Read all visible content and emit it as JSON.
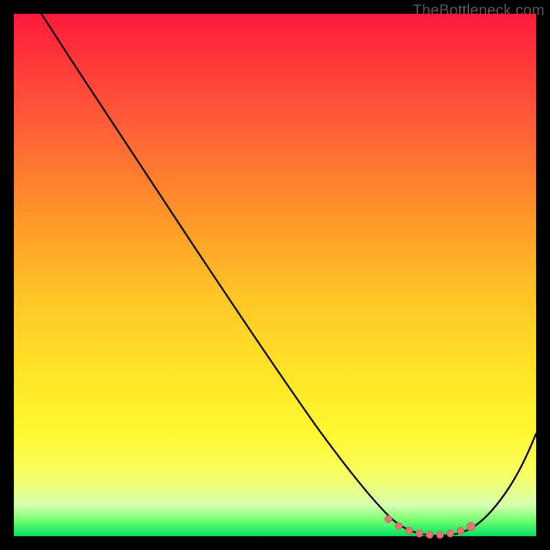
{
  "watermark": "TheBottleneck.com",
  "chart_data": {
    "type": "line",
    "title": "",
    "xlabel": "",
    "ylabel": "",
    "xlim": [
      0,
      100
    ],
    "ylim": [
      0,
      100
    ],
    "grid": false,
    "legend": false,
    "series": [
      {
        "name": "bottleneck-curve",
        "x": [
          0,
          5,
          10,
          15,
          20,
          25,
          30,
          35,
          40,
          45,
          50,
          55,
          60,
          65,
          70,
          73,
          76,
          79,
          82,
          85,
          88,
          91,
          94,
          97,
          100
        ],
        "values": [
          100,
          96,
          92,
          87,
          81,
          75,
          69,
          62,
          55,
          48,
          41,
          34,
          27,
          20,
          12,
          7,
          3,
          1,
          0,
          0,
          1,
          4,
          9,
          16,
          25
        ]
      },
      {
        "name": "optimal-range-markers",
        "marker_color": "#e57373",
        "x": [
          72,
          74,
          76,
          78,
          80,
          82,
          84,
          86,
          88
        ],
        "values": [
          2.5,
          1.5,
          1.0,
          0.5,
          0.5,
          0.5,
          1.0,
          1.5,
          2.5
        ]
      }
    ],
    "colors": {
      "curve": "#000000",
      "marker": "#e57373",
      "gradient_top": "#ff1a3c",
      "gradient_bottom": "#00e060"
    }
  }
}
